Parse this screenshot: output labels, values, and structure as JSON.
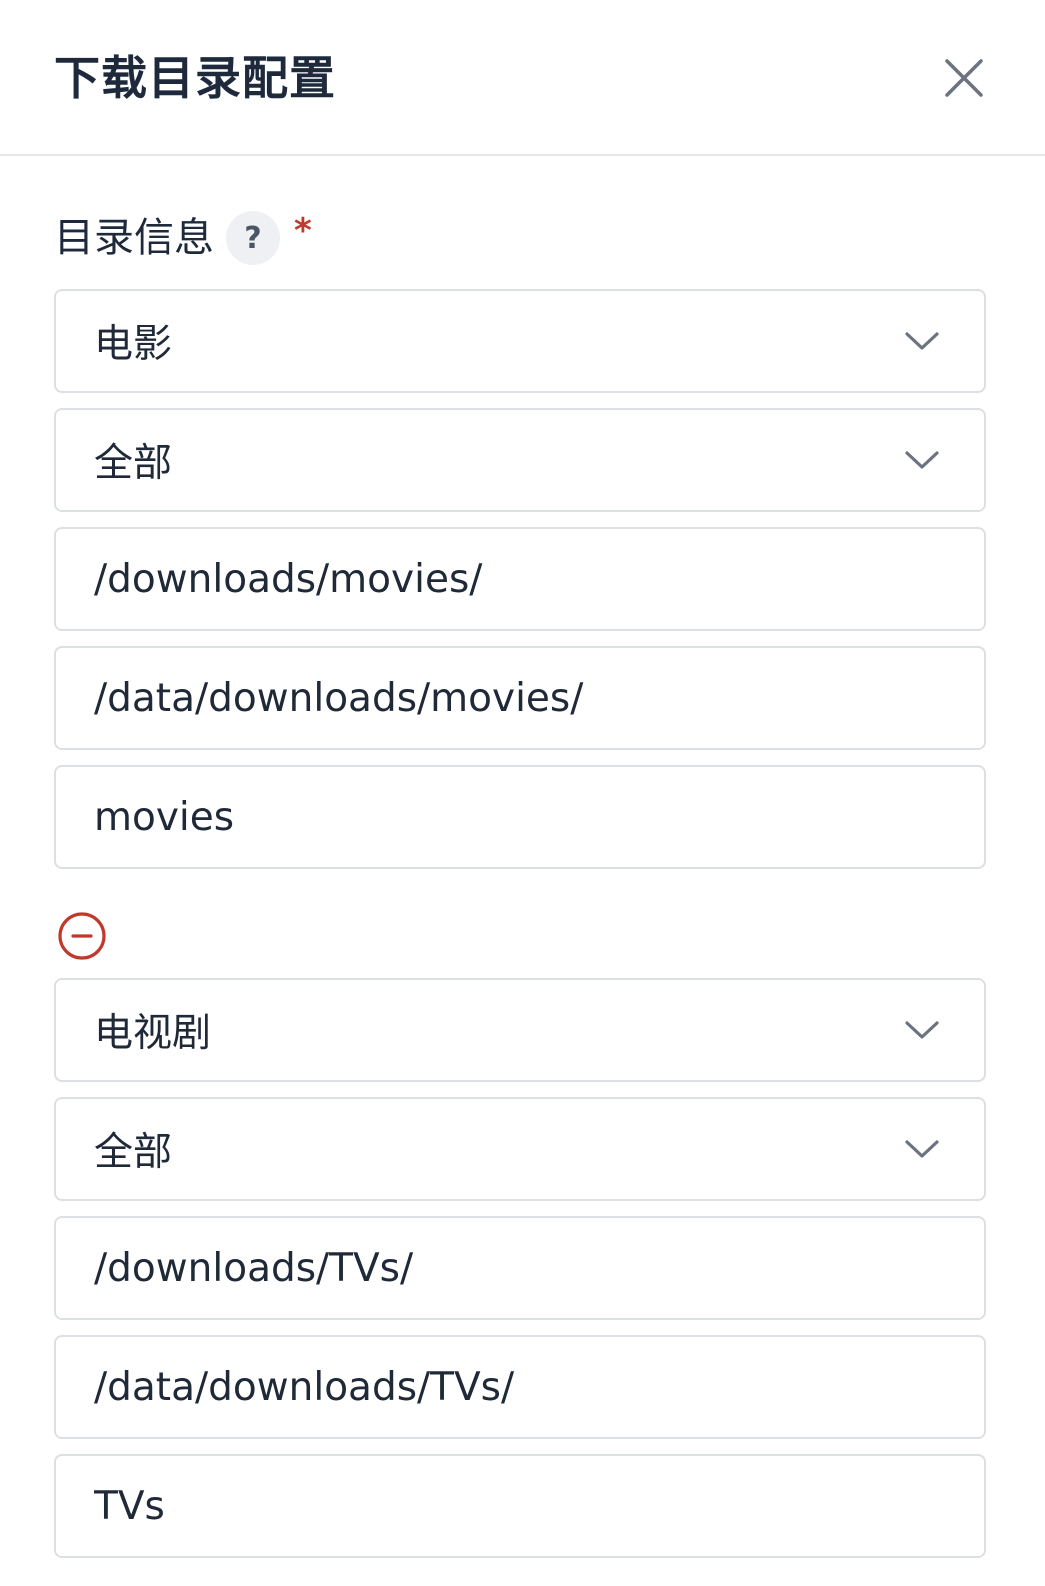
{
  "dialog": {
    "title": "下载目录配置",
    "close_icon": "close-icon"
  },
  "field": {
    "label": "目录信息",
    "help_glyph": "?",
    "required_glyph": "*",
    "required_color": "#c0392b"
  },
  "entries": [
    {
      "media_type": "电影",
      "category": "全部",
      "download_path": "/downloads/movies/",
      "save_path": "/data/downloads/movies/",
      "label": "movies"
    },
    {
      "media_type": "电视剧",
      "category": "全部",
      "download_path": "/downloads/TVs/",
      "save_path": "/data/downloads/TVs/",
      "label": "TVs"
    }
  ],
  "remove_icon": "minus-circle-icon",
  "select_icon": "chevron-down-icon"
}
